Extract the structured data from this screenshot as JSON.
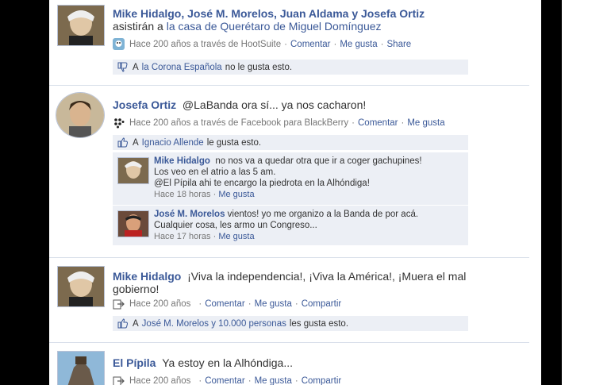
{
  "posts": [
    {
      "author": "Mike Hidalgo, José M. Morelos, Juan Aldama y Josefa Ortiz",
      "text_pre": "asistirán a ",
      "text_link": "la casa de Querétaro de Miguel Domínguez",
      "time": "Hace 200 años a través de HootSuite",
      "actions": [
        "Comentar",
        "Me gusta",
        "Share"
      ],
      "reaction_actor": "la Corona Española",
      "reaction_text": "no le gusta esto.",
      "reaction_prefix": "A"
    },
    {
      "author": "Josefa Ortiz",
      "text": "@LaBanda ora sí... ya nos cacharon!",
      "time": "Hace 200 años a través de Facebook para BlackBerry",
      "actions": [
        "Comentar",
        "Me gusta"
      ],
      "reaction_prefix": "A",
      "reaction_actor": "Ignacio Allende",
      "reaction_text": "le gusta esto.",
      "comments": [
        {
          "author": "Mike Hidalgo",
          "line1": "no nos va a quedar otra que ir a coger gachupines!",
          "line2": "Los veo en el atrio a las 5 am.",
          "line3": "@El Pípila ahi te encargo la piedrota en la Alhóndiga!",
          "time": "Hace 18 horas",
          "action": "Me gusta"
        },
        {
          "author": "José M. Morelos",
          "line1": "vientos! yo me organizo a la Banda de por acá.",
          "line2": "Cualquier cosa, les armo un Congreso...",
          "time": "Hace 17 horas",
          "action": "Me gusta"
        }
      ]
    },
    {
      "author": "Mike Hidalgo",
      "text": "¡Viva la independencia!, ¡Viva la América!, ¡Muera el mal gobierno!",
      "time": "Hace 200 años",
      "actions": [
        "Comentar",
        "Me gusta",
        "Compartir"
      ],
      "reaction_prefix": "A",
      "reaction_actor": "José M. Morelos y 10.000 personas",
      "reaction_text": "les gusta esto."
    },
    {
      "author": "El Pípila",
      "text": "Ya estoy en la Alhóndiga...",
      "time": "Hace 200 años",
      "actions": [
        "Comentar",
        "Me gusta",
        "Compartir"
      ]
    }
  ],
  "colors": {
    "link": "#3b5998",
    "likebox": "#eceff5",
    "separator": "#d8dfea"
  }
}
